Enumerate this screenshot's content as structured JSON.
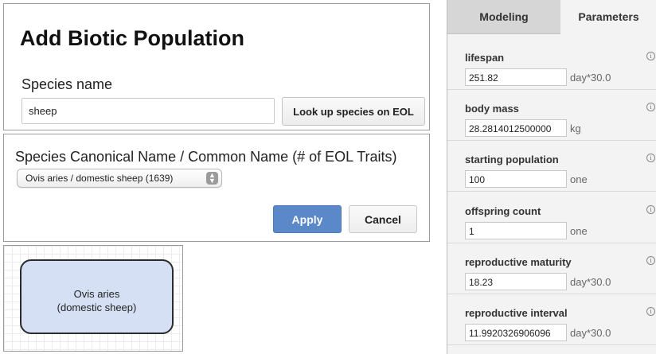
{
  "add_panel": {
    "title": "Add Biotic Population",
    "species_label": "Species name",
    "species_value": "sheep",
    "lookup_button": "Look up species on EOL"
  },
  "canon_panel": {
    "title": "Species Canonical Name / Common Name (# of EOL Traits)",
    "selected_option": "Ovis aries / domestic sheep (1639)",
    "apply_button": "Apply",
    "cancel_button": "Cancel"
  },
  "diagram": {
    "node_line1": "Ovis aries",
    "node_line2": "(domestic sheep)"
  },
  "right_panel": {
    "tabs": [
      {
        "label": "Modeling"
      },
      {
        "label": "Parameters"
      }
    ],
    "params": [
      {
        "name": "lifespan",
        "value": "251.82",
        "unit": "day*30.0"
      },
      {
        "name": "body mass",
        "value": "28.2814012500000",
        "unit": "kg"
      },
      {
        "name": "starting population",
        "value": "100",
        "unit": "one"
      },
      {
        "name": "offspring count",
        "value": "1",
        "unit": "one"
      },
      {
        "name": "reproductive maturity",
        "value": "18.23",
        "unit": "day*30.0"
      },
      {
        "name": "reproductive interval",
        "value": "11.9920326906096",
        "unit": "day*30.0"
      }
    ]
  },
  "colors": {
    "apply_blue": "#5b88c8",
    "node_fill": "#d5e0f4"
  }
}
